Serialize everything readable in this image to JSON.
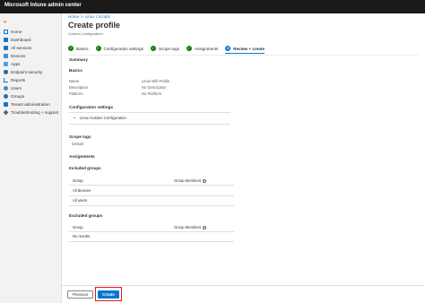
{
  "app": {
    "title": "Microsoft Intune admin center"
  },
  "sidebar": {
    "collapse_icon": "«",
    "items": [
      {
        "label": "Home",
        "icon": "home-icon"
      },
      {
        "label": "Dashboard",
        "icon": "dashboard-icon"
      },
      {
        "label": "All services",
        "icon": "all-services-icon"
      },
      {
        "label": "Devices",
        "icon": "devices-icon"
      },
      {
        "label": "Apps",
        "icon": "apps-icon"
      },
      {
        "label": "Endpoint security",
        "icon": "shield-icon"
      },
      {
        "label": "Reports",
        "icon": "reports-icon"
      },
      {
        "label": "Users",
        "icon": "user-icon"
      },
      {
        "label": "Groups",
        "icon": "groups-icon"
      },
      {
        "label": "Tenant administration",
        "icon": "tenant-icon"
      },
      {
        "label": "Troubleshooting + support",
        "icon": "wrench-icon"
      }
    ]
  },
  "breadcrumb": {
    "items": [
      "Home",
      "Linux | Scripts"
    ],
    "separator": ">"
  },
  "header": {
    "title": "Create profile",
    "more": "···",
    "subtitle": "Custom Configuration"
  },
  "steps": [
    {
      "label": "Basics",
      "mark": "✓"
    },
    {
      "label": "Configuration settings",
      "mark": "✓"
    },
    {
      "label": "Scope tags",
      "mark": "✓"
    },
    {
      "label": "Assignments",
      "mark": "✓"
    },
    {
      "label": "Review + create",
      "mark": "5"
    }
  ],
  "summary": {
    "heading": "Summary",
    "basics": {
      "heading": "Basics",
      "rows": [
        {
          "label": "Name",
          "value": "Linux Wifi Profile"
        },
        {
          "label": "Description",
          "value": "No Description"
        },
        {
          "label": "Platform",
          "value": "No Platform"
        }
      ]
    },
    "configuration": {
      "heading": "Configuration settings",
      "accordion_label": "Linux Custom Configuration",
      "chevron": "⌄"
    },
    "scope_tags": {
      "heading": "Scope tags",
      "value": "Default"
    },
    "assignments": {
      "heading": "Assignments",
      "included": {
        "heading": "Included groups",
        "columns": [
          "Group",
          "Group Members"
        ],
        "rows": [
          "All devices",
          "All users"
        ]
      },
      "excluded": {
        "heading": "Excluded groups",
        "columns": [
          "Group",
          "Group Members"
        ],
        "rows": [
          "No results."
        ]
      }
    }
  },
  "footer": {
    "previous_label": "Previous",
    "create_label": "Create"
  },
  "colors": {
    "accent": "#0078d4",
    "complete": "#107c10",
    "highlight": "#e81123",
    "topbar": "#1b1a19"
  }
}
